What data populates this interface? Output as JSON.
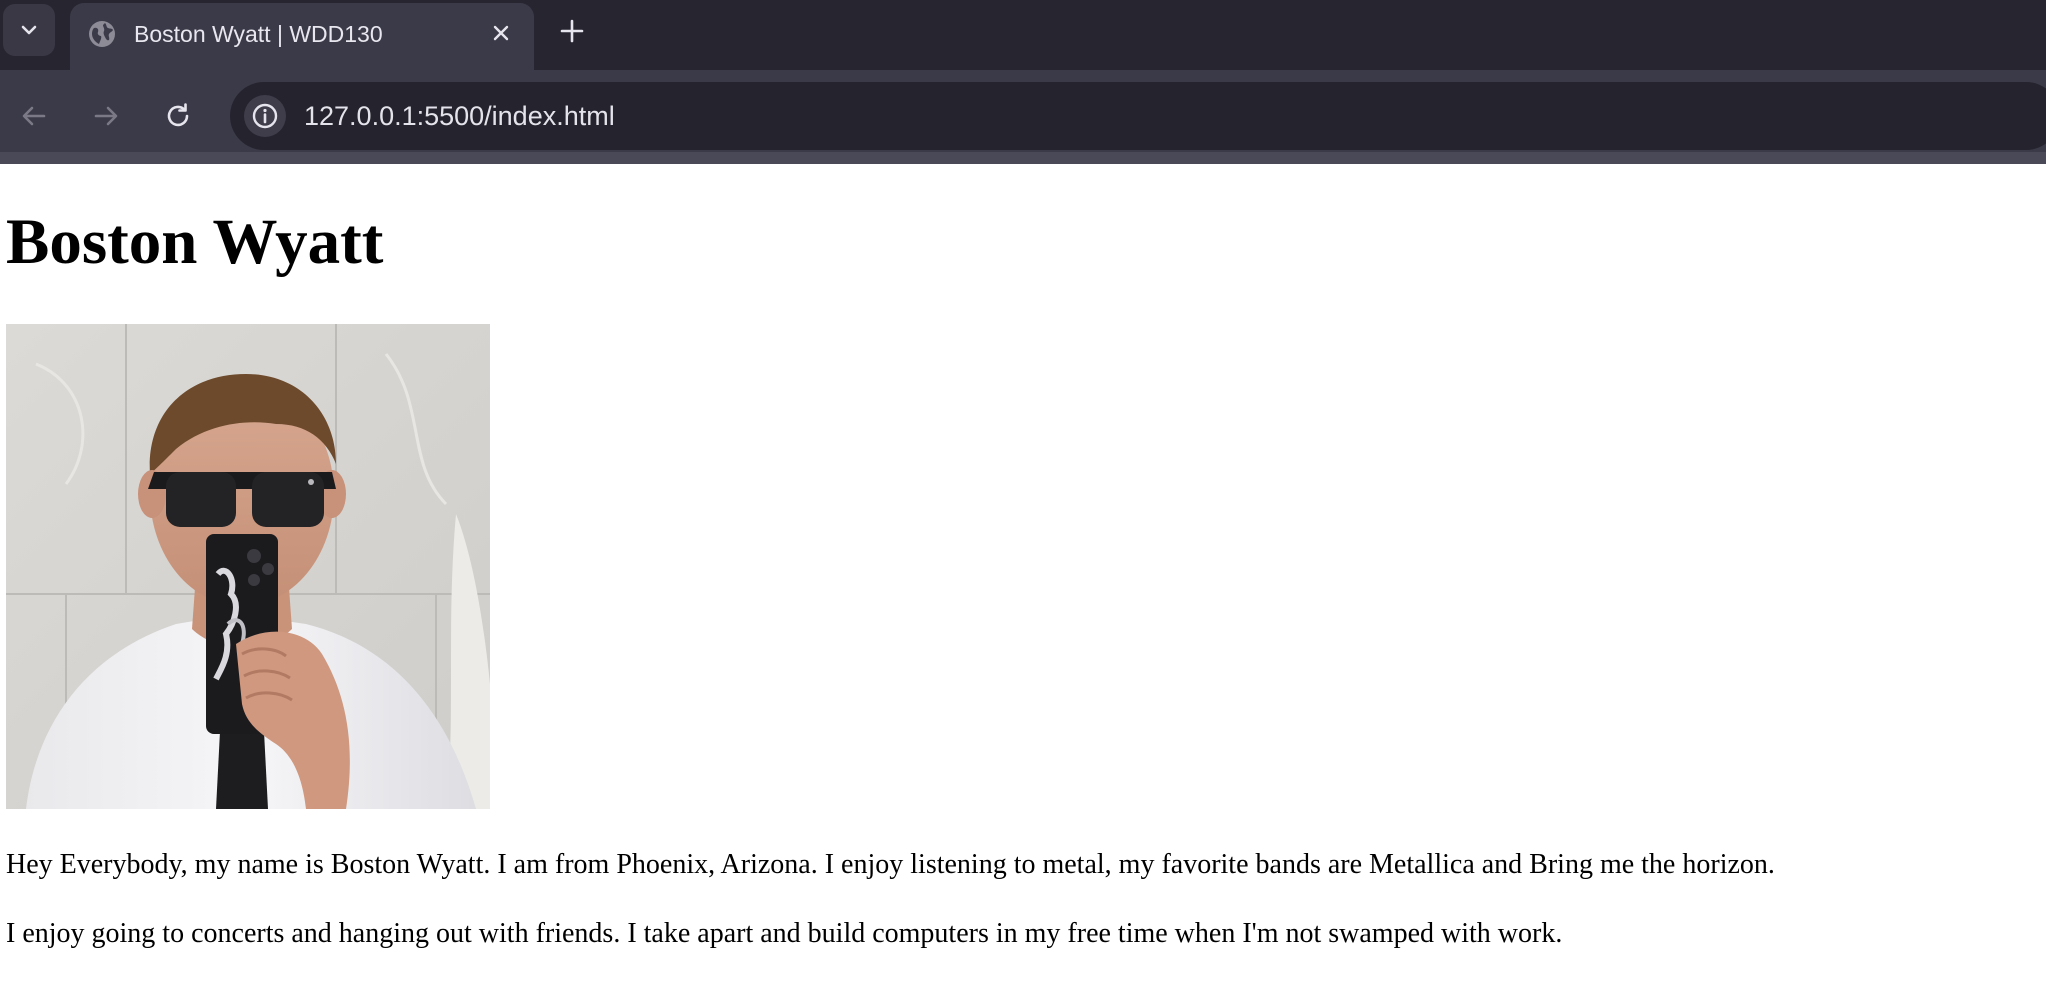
{
  "browser": {
    "tab": {
      "title": "Boston Wyatt | WDD130",
      "favicon": "globe-icon"
    },
    "tab_menu_icon": "chevron-down-icon",
    "new_tab_icon": "plus-icon",
    "nav": {
      "back_icon": "arrow-left-icon",
      "forward_icon": "arrow-right-icon",
      "reload_icon": "reload-icon"
    },
    "address_bar": {
      "site_info_icon": "info-icon",
      "url": "127.0.0.1:5500/index.html"
    },
    "colors": {
      "tabstrip": "#27252f",
      "toolbar": "#3b3a48",
      "omnibox": "#25232d"
    }
  },
  "page": {
    "heading": "Boston Wyatt",
    "photo": {
      "subject": "selfie of a man in sunglasses, white shirt and black tie holding a phone"
    },
    "paragraphs": [
      "Hey Everybody, my name is Boston Wyatt. I am from Phoenix, Arizona. I enjoy listening to metal, my favorite bands are Metallica and Bring me the horizon.",
      "I enjoy going to concerts and hanging out with friends. I take apart and build computers in my free time when I'm not swamped with work."
    ]
  }
}
